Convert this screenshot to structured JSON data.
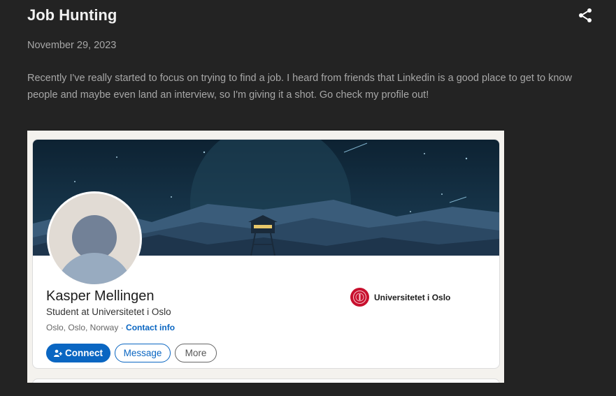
{
  "post": {
    "title": "Job Hunting",
    "date": "November 29, 2023",
    "body": " Recently I've really started to focus on trying to find a job. I heard from friends that Linkedin is a good place to get to know people and maybe even land an interview, so I'm giving it a shot. Go check my profile out!"
  },
  "icons": {
    "share": "share-icon",
    "connect": "add-person-icon",
    "school": "university-seal-icon"
  },
  "profile": {
    "name": "Kasper Mellingen",
    "headline": "Student at Universitetet i Oslo",
    "location": "Oslo, Oslo, Norway",
    "location_separator": " · ",
    "contact_label": "Contact info",
    "school": "Universitetet i Oslo",
    "buttons": {
      "connect": "Connect",
      "message": "Message",
      "more": "More"
    }
  },
  "colors": {
    "page_bg": "#232323",
    "title": "#f1f1f1",
    "muted_text": "#a7a7a7",
    "linkedin_blue": "#0a66c2",
    "school_red": "#c8102e"
  }
}
